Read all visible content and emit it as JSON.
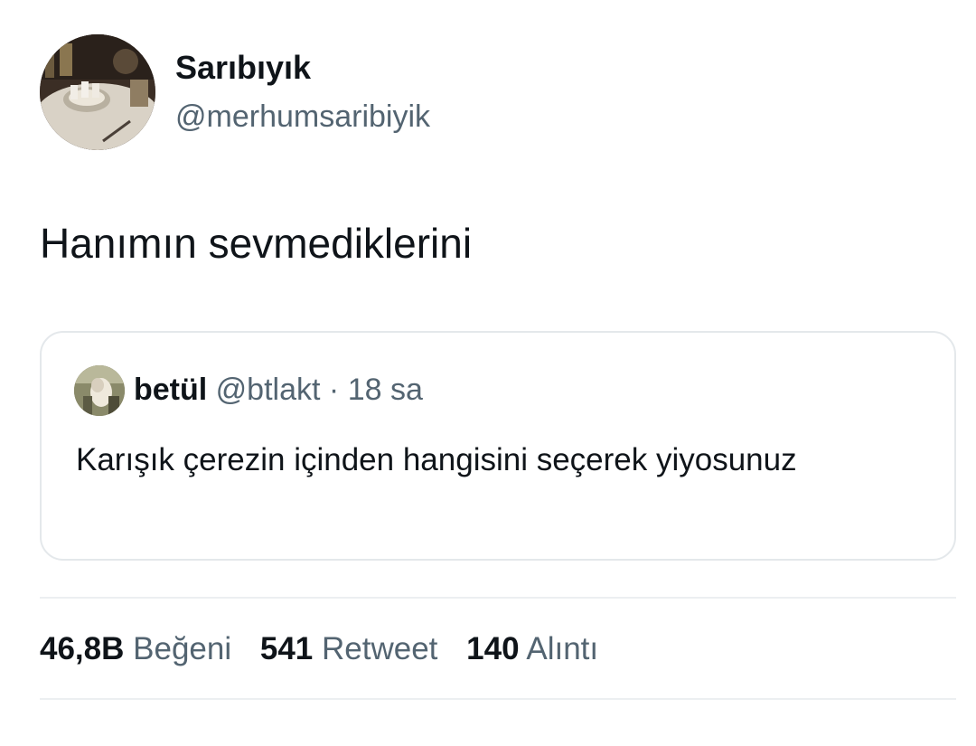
{
  "author": {
    "display_name": "Sarıbıyık",
    "handle": "@merhumsaribiyik"
  },
  "tweet": {
    "text": "Hanımın sevmediklerini"
  },
  "quoted_tweet": {
    "display_name": "betül",
    "handle": "@btlakt",
    "separator": "·",
    "time": "18 sa",
    "text": "Karışık çerezin içinden hangisini seçerek yiyosunuz"
  },
  "stats": {
    "likes_count": "46,8B",
    "likes_label": "Beğeni",
    "retweets_count": "541",
    "retweets_label": "Retweet",
    "quotes_count": "140",
    "quotes_label": "Alıntı"
  }
}
